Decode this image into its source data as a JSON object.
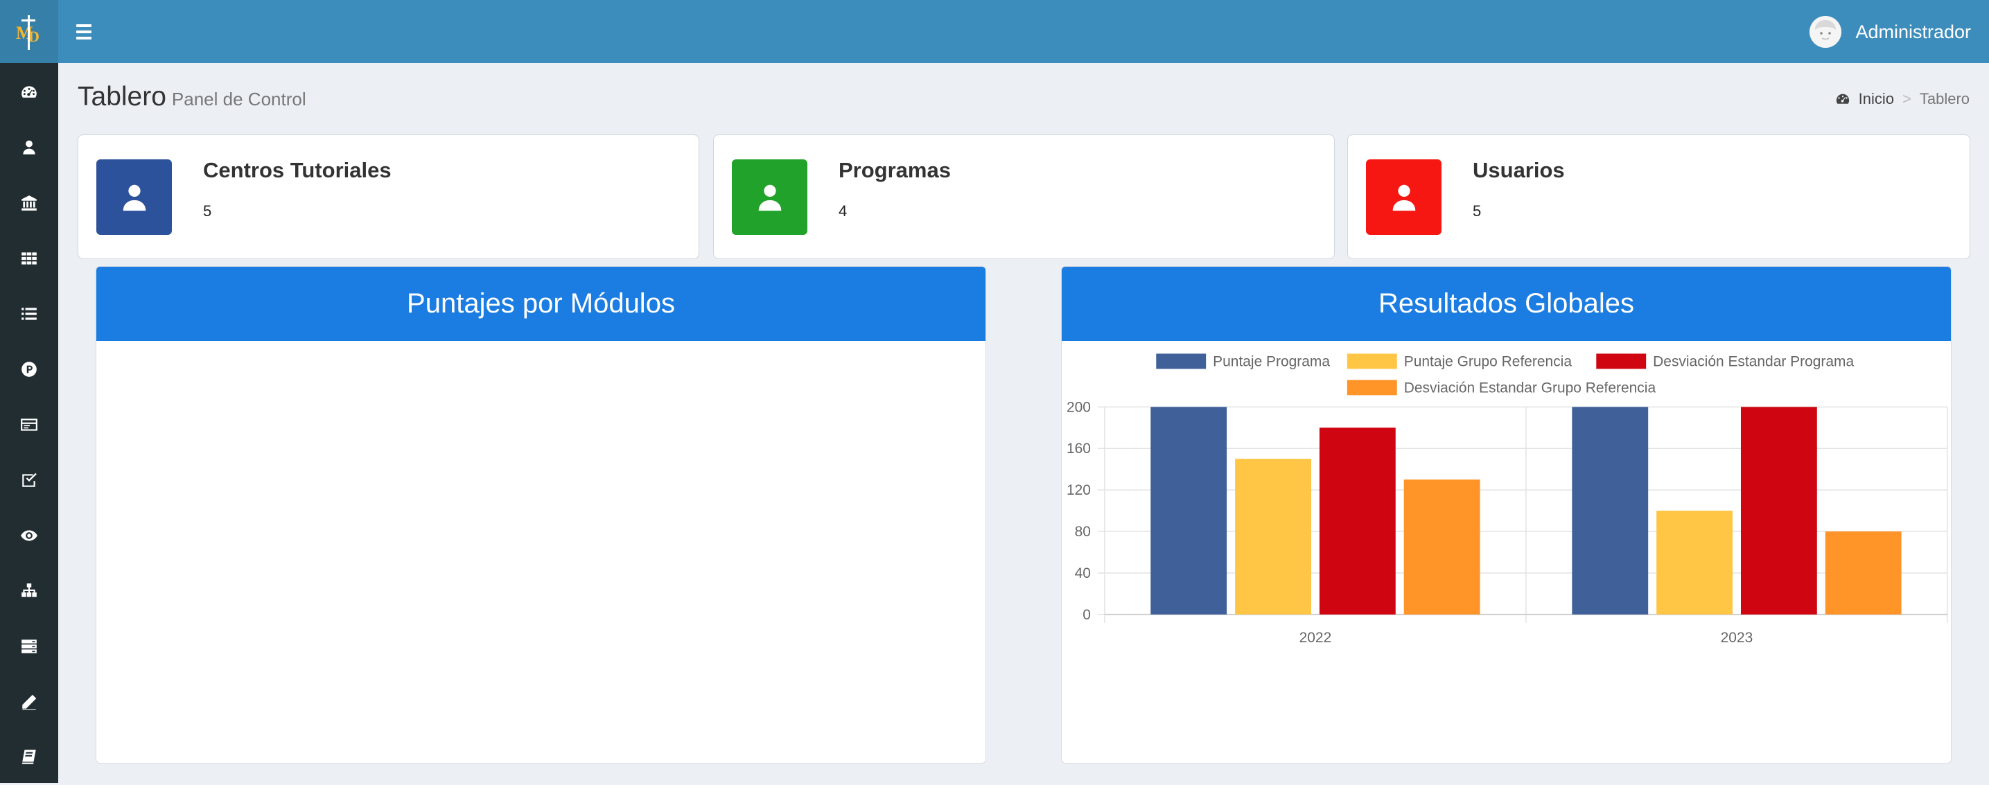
{
  "user": {
    "name": "Administrador"
  },
  "page": {
    "title": "Tablero",
    "subtitle": "Panel de Control"
  },
  "breadcrumb": {
    "home": "Inicio",
    "separator": ">",
    "current": "Tablero"
  },
  "sidebar": {
    "items": [
      {
        "icon": "dashboard-icon"
      },
      {
        "icon": "user-icon"
      },
      {
        "icon": "institution-icon"
      },
      {
        "icon": "grid-icon"
      },
      {
        "icon": "list-icon"
      },
      {
        "icon": "parking-icon"
      },
      {
        "icon": "card-icon"
      },
      {
        "icon": "checkbox-icon"
      },
      {
        "icon": "eye-icon"
      },
      {
        "icon": "sitemap-icon"
      },
      {
        "icon": "server-icon"
      },
      {
        "icon": "pencil-icon"
      },
      {
        "icon": "book-icon"
      }
    ]
  },
  "info_boxes": [
    {
      "title": "Centros Tutoriales",
      "value": "5",
      "color": "#2c529b",
      "icon": "user-icon"
    },
    {
      "title": "Programas",
      "value": "4",
      "color": "#21a32b",
      "icon": "user-icon"
    },
    {
      "title": "Usuarios",
      "value": "5",
      "color": "#f71712",
      "icon": "user-icon"
    }
  ],
  "panels": {
    "left": {
      "title": "Puntajes por Módulos"
    },
    "right": {
      "title": "Resultados Globales"
    }
  },
  "colors": {
    "header_blue": "#3c8dbc",
    "panel_blue": "#1b7ce1",
    "sidebar_dark": "#222d32"
  },
  "chart_data": {
    "type": "bar",
    "title": "Resultados Globales",
    "categories": [
      "2022",
      "2023"
    ],
    "series": [
      {
        "name": "Puntaje Programa",
        "color": "#3f6099",
        "values": [
          200,
          200
        ]
      },
      {
        "name": "Puntaje Grupo Referencia",
        "color": "#ffc645",
        "values": [
          150,
          100
        ]
      },
      {
        "name": "Desviación Estandar Programa",
        "color": "#cf0511",
        "values": [
          180,
          200
        ]
      },
      {
        "name": "Desviación Estandar Grupo Referencia",
        "color": "#ff9428",
        "values": [
          130,
          80
        ]
      }
    ],
    "ylim": [
      0,
      200
    ],
    "yticks": [
      0,
      40,
      80,
      120,
      160,
      200
    ],
    "grid": true,
    "legend": "top"
  }
}
